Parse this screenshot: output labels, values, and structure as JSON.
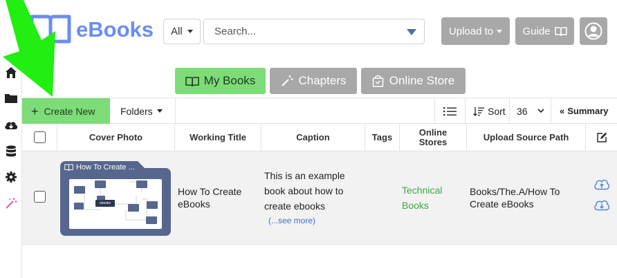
{
  "app": {
    "title": "eBooks"
  },
  "header": {
    "scope_value": "All",
    "search_placeholder": "Search...",
    "upload_label": "Upload to",
    "guide_label": "Guide"
  },
  "tabs": [
    {
      "label": "My Books",
      "active": true
    },
    {
      "label": "Chapters",
      "active": false
    },
    {
      "label": "Online Store",
      "active": false
    }
  ],
  "toolbar": {
    "create_label": "Create New",
    "folders_label": "Folders",
    "sort_label": "Sort",
    "page_size": "36",
    "summary_label": "Summary"
  },
  "table": {
    "headers": [
      "Cover Photo",
      "Working Title",
      "Caption",
      "Tags",
      "Online Stores",
      "Upload Source Path"
    ],
    "rows": [
      {
        "cover_title": "How To Create ...",
        "cover_center_label": "ebooks",
        "title": "How To Create eBooks",
        "caption": "This is an example book about how to create ebooks",
        "see_more": "(...see more)",
        "tags": "",
        "store": "Technical Books",
        "path": "Books/The.A/How To Create eBooks"
      }
    ]
  },
  "colors": {
    "brand": "#6a8df1",
    "active_tab": "#7ddc77",
    "inactive_tab": "#a8a8a8",
    "store_text": "#3aa845",
    "link": "#3a6fd0",
    "arrow": "#22ee11",
    "sidebar_highlight": "#e05ad8"
  },
  "icons": [
    "home-icon",
    "folder-icon",
    "cloud-download-icon",
    "database-icon",
    "gear-icon",
    "magic-wand-icon",
    "book-icon",
    "user-icon",
    "list-icon",
    "sort-icon",
    "chevrons-left-icon",
    "edit-icon",
    "cloud-upload-icon"
  ]
}
